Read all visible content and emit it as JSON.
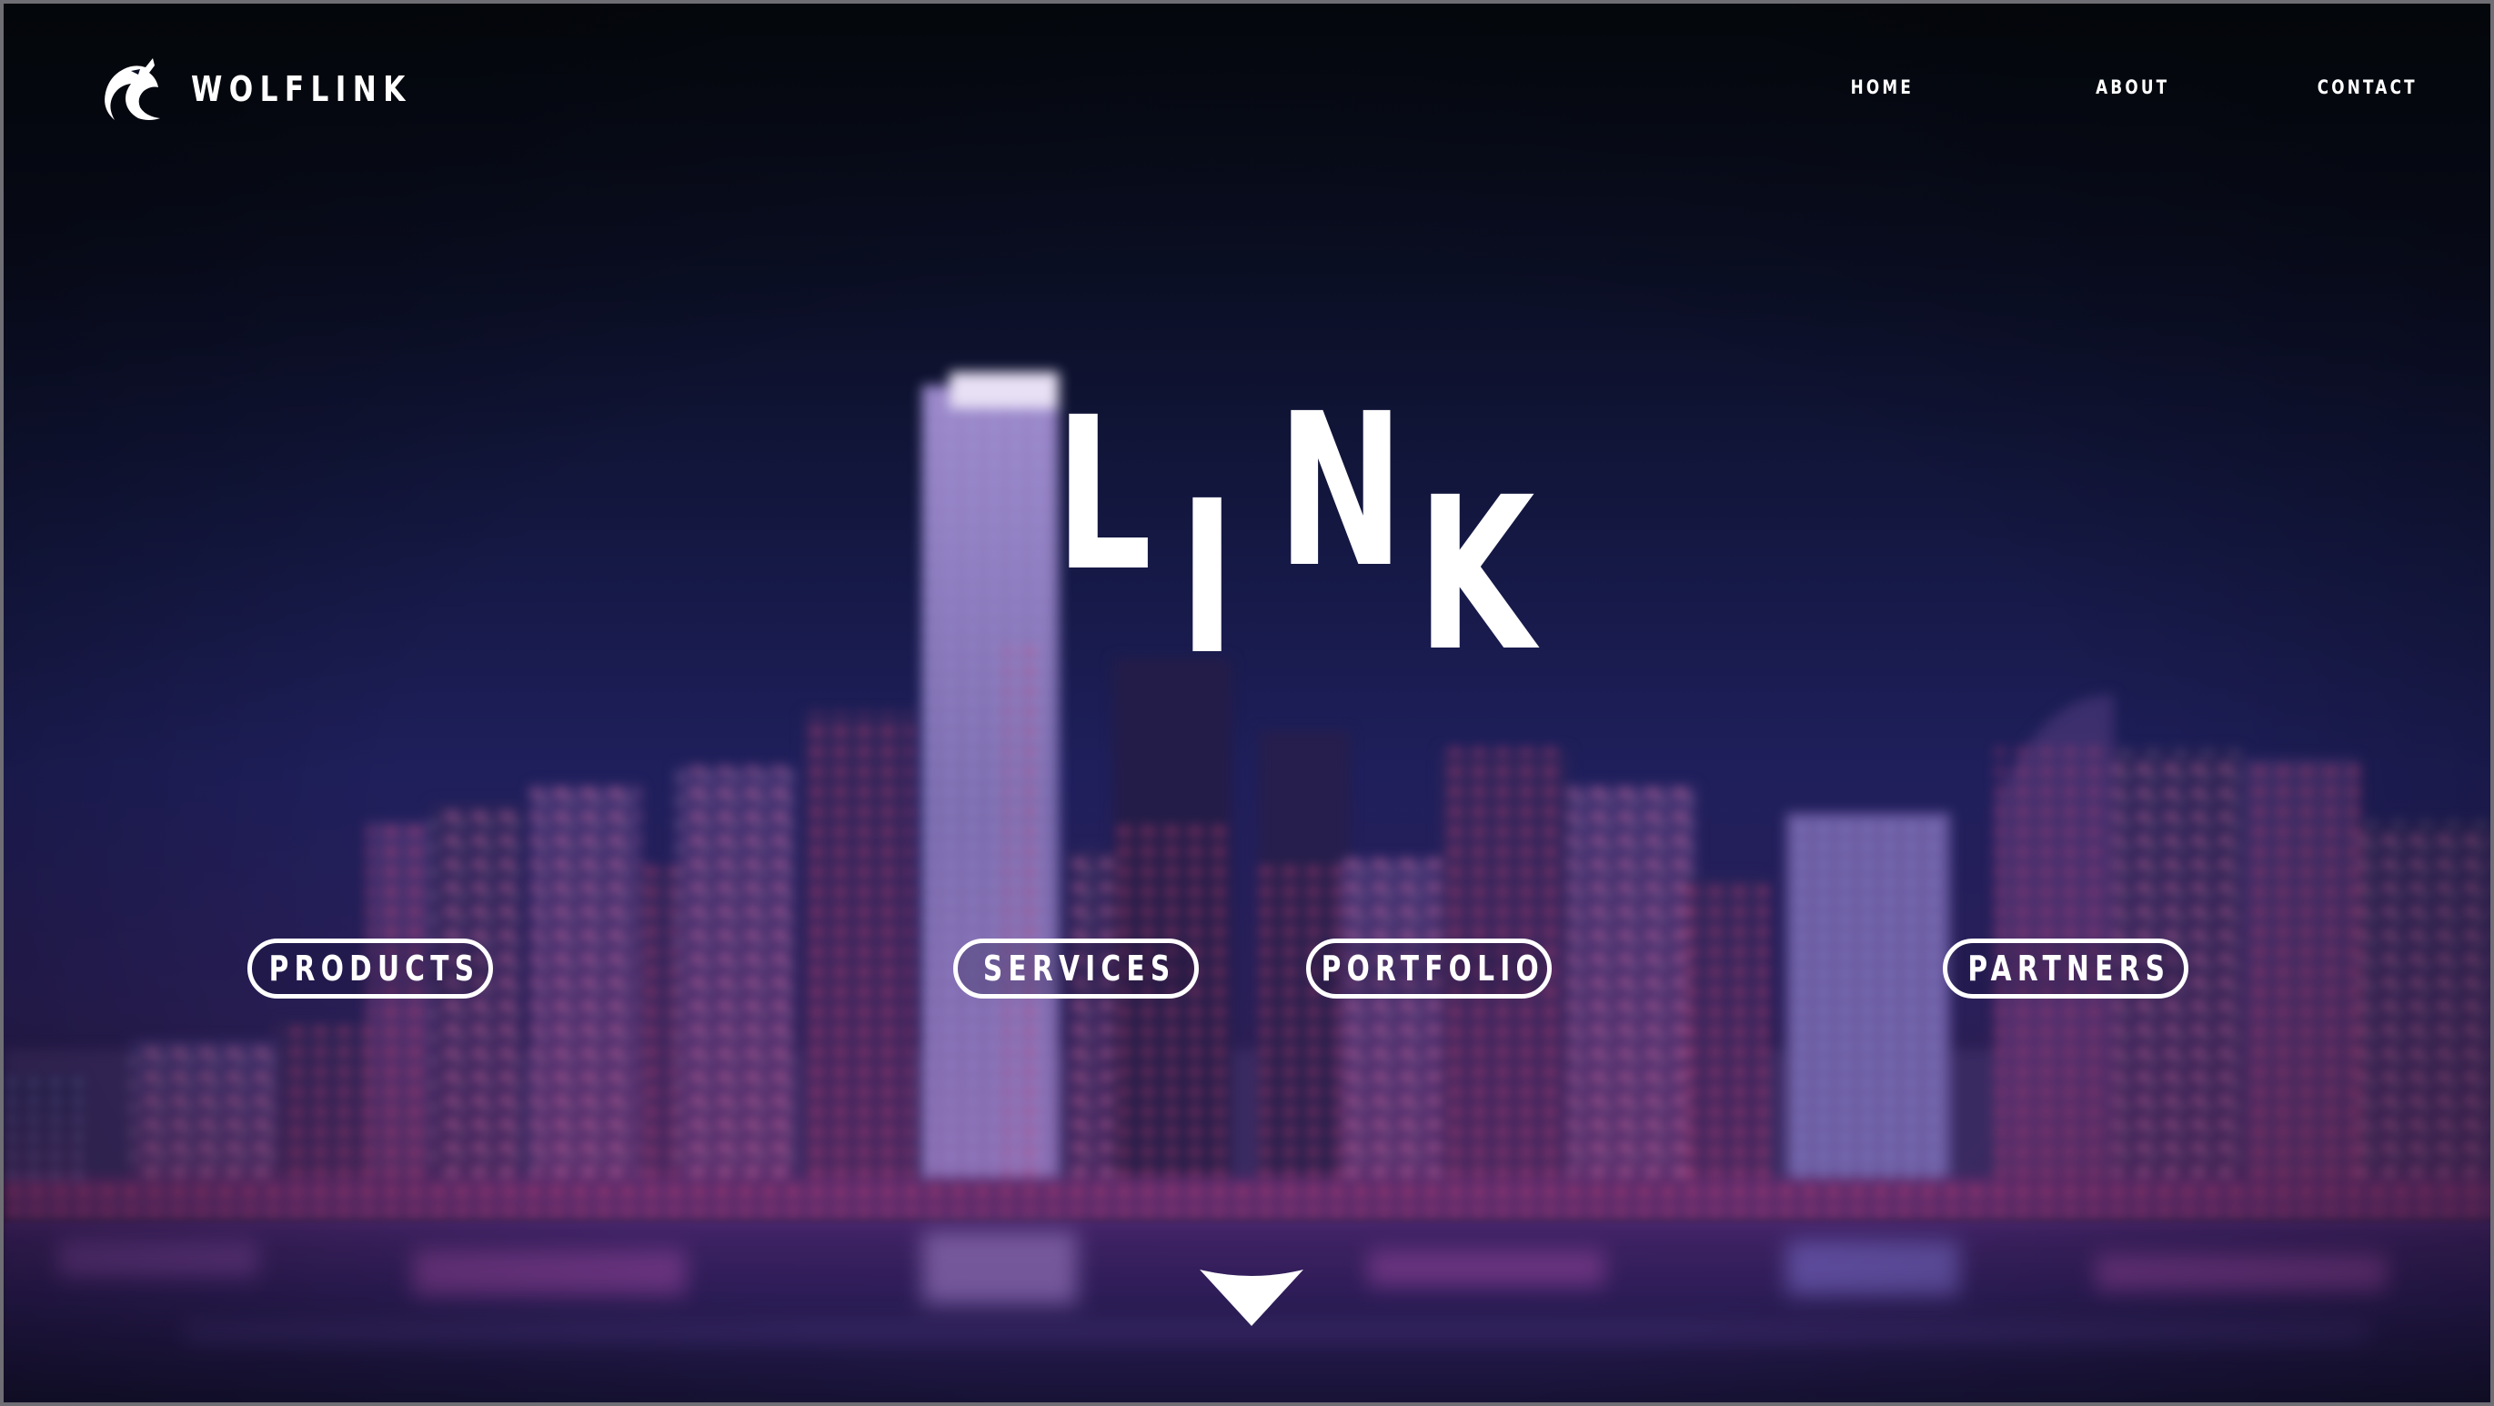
{
  "header": {
    "logo_text": "WOLFLINK",
    "logo_icon": "wolf-head-icon",
    "nav": [
      {
        "label": "HOME"
      },
      {
        "label": "ABOUT"
      },
      {
        "label": "CONTACT"
      }
    ]
  },
  "hero": {
    "title_letters": [
      "L",
      "I",
      "N",
      "K"
    ]
  },
  "buttons": [
    {
      "label": "PRODUCTS"
    },
    {
      "label": "SERVICES"
    },
    {
      "label": "PORTFOLIO"
    },
    {
      "label": "PARTNERS"
    }
  ],
  "scroll_icon": "chevron-down-icon",
  "colors": {
    "text": "#ffffff",
    "sky_top": "#05090f",
    "sky_mid": "#1f1f5c",
    "city_glow": "#e0407a"
  }
}
